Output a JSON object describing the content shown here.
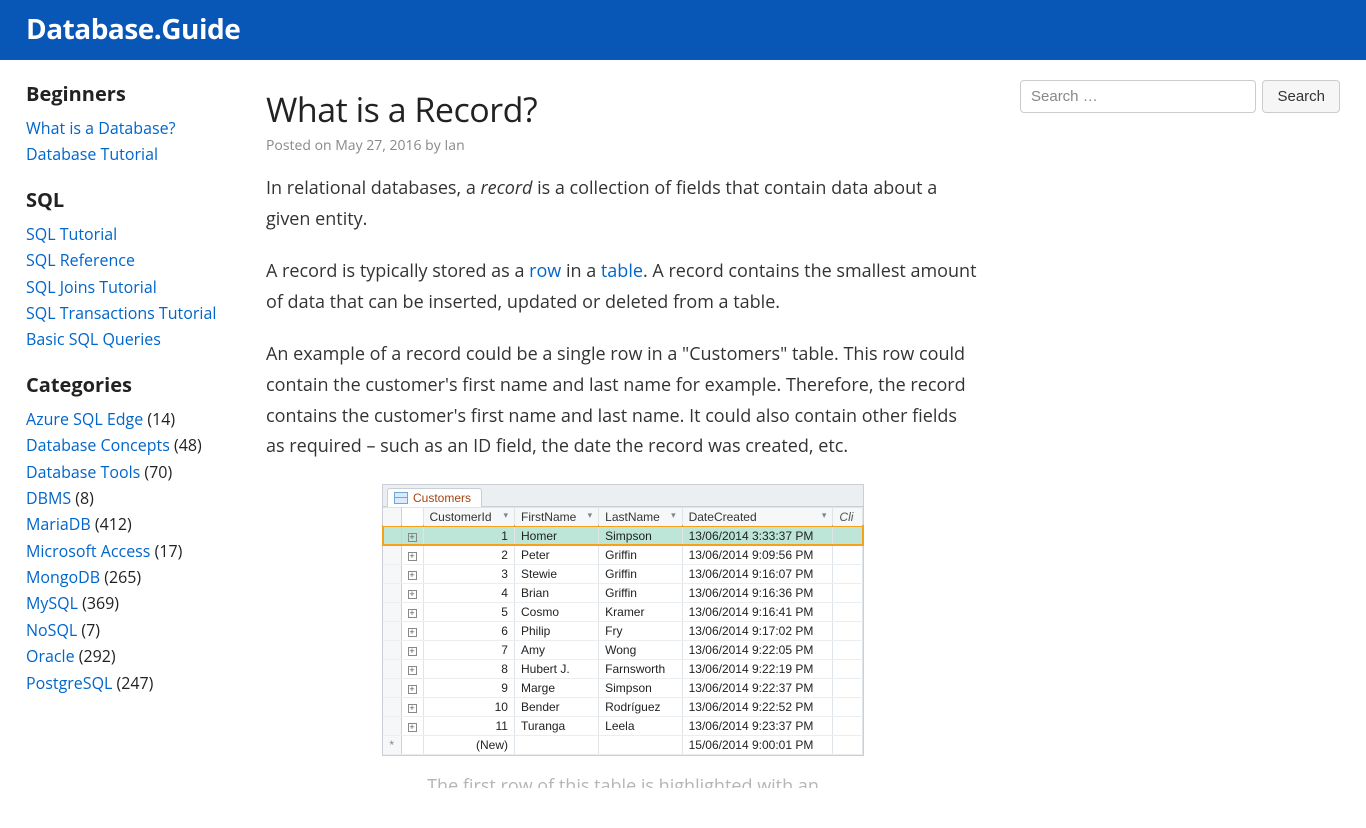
{
  "header": {
    "site_title": "Database.Guide"
  },
  "sidebar": {
    "sections": [
      {
        "heading": "Beginners",
        "items": [
          {
            "label": "What is a Database?"
          },
          {
            "label": "Database Tutorial"
          }
        ]
      },
      {
        "heading": "SQL",
        "items": [
          {
            "label": "SQL Tutorial"
          },
          {
            "label": "SQL Reference"
          },
          {
            "label": "SQL Joins Tutorial"
          },
          {
            "label": "SQL Transactions Tutorial"
          },
          {
            "label": "Basic SQL Queries"
          }
        ]
      },
      {
        "heading": "Categories",
        "items": [
          {
            "label": "Azure SQL Edge",
            "count": "(14)"
          },
          {
            "label": "Database Concepts",
            "count": "(48)"
          },
          {
            "label": "Database Tools",
            "count": "(70)"
          },
          {
            "label": "DBMS",
            "count": "(8)"
          },
          {
            "label": "MariaDB",
            "count": "(412)"
          },
          {
            "label": "Microsoft Access",
            "count": "(17)"
          },
          {
            "label": "MongoDB",
            "count": "(265)"
          },
          {
            "label": "MySQL",
            "count": "(369)"
          },
          {
            "label": "NoSQL",
            "count": "(7)"
          },
          {
            "label": "Oracle",
            "count": "(292)"
          },
          {
            "label": "PostgreSQL",
            "count": "(247)"
          }
        ]
      }
    ]
  },
  "article": {
    "title": "What is a Record?",
    "meta": {
      "posted_prefix": "Posted on ",
      "date": "May 27, 2016",
      "by_prefix": " by ",
      "author": "Ian"
    },
    "p1_a": "In relational databases, a ",
    "p1_em": "record",
    "p1_b": " is a collection of fields that contain data about a given entity.",
    "p2_a": "A record is typically stored as a ",
    "p2_link1": "row",
    "p2_b": " in a ",
    "p2_link2": "table",
    "p2_c": ". A record contains the smallest amount of data that can be inserted, updated or deleted from a table.",
    "p3": "An example of a record could be a single row in a \"Customers\" table. This row could contain the customer's first name and last name for example. Therefore, the record contains the customer's first name and last name. It could also contain other fields as required – such as an ID field, the date the record was created, etc.",
    "caption_partial": "The first row of this table is highlighted with an"
  },
  "search": {
    "placeholder": "Search …",
    "button": "Search"
  },
  "dbshot": {
    "tab_label": "Customers",
    "columns": [
      "CustomerId",
      "FirstName",
      "LastName",
      "DateCreated",
      "Cli"
    ],
    "rows": [
      {
        "id": "1",
        "first": "Homer",
        "last": "Simpson",
        "date": "13/06/2014 3:33:37 PM",
        "hl": true
      },
      {
        "id": "2",
        "first": "Peter",
        "last": "Griffin",
        "date": "13/06/2014 9:09:56 PM"
      },
      {
        "id": "3",
        "first": "Stewie",
        "last": "Griffin",
        "date": "13/06/2014 9:16:07 PM"
      },
      {
        "id": "4",
        "first": "Brian",
        "last": "Griffin",
        "date": "13/06/2014 9:16:36 PM"
      },
      {
        "id": "5",
        "first": "Cosmo",
        "last": "Kramer",
        "date": "13/06/2014 9:16:41 PM"
      },
      {
        "id": "6",
        "first": "Philip",
        "last": "Fry",
        "date": "13/06/2014 9:17:02 PM"
      },
      {
        "id": "7",
        "first": "Amy",
        "last": "Wong",
        "date": "13/06/2014 9:22:05 PM"
      },
      {
        "id": "8",
        "first": "Hubert J.",
        "last": "Farnsworth",
        "date": "13/06/2014 9:22:19 PM"
      },
      {
        "id": "9",
        "first": "Marge",
        "last": "Simpson",
        "date": "13/06/2014 9:22:37 PM"
      },
      {
        "id": "10",
        "first": "Bender",
        "last": "Rodríguez",
        "date": "13/06/2014 9:22:52 PM"
      },
      {
        "id": "11",
        "first": "Turanga",
        "last": "Leela",
        "date": "13/06/2014 9:23:37 PM"
      }
    ],
    "new_row": {
      "label": "(New)",
      "date": "15/06/2014 9:00:01 PM",
      "marker": "*"
    }
  }
}
